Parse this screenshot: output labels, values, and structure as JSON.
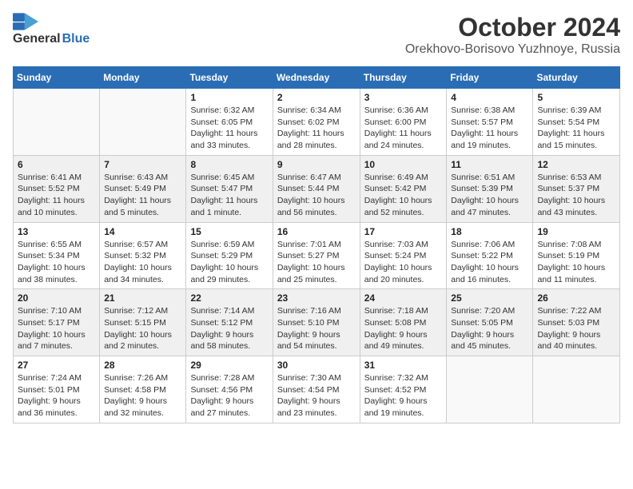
{
  "header": {
    "logo_general": "General",
    "logo_blue": "Blue",
    "month_title": "October 2024",
    "location": "Orekhovo-Borisovo Yuzhnoye, Russia"
  },
  "days_of_week": [
    "Sunday",
    "Monday",
    "Tuesday",
    "Wednesday",
    "Thursday",
    "Friday",
    "Saturday"
  ],
  "weeks": [
    [
      {
        "day": "",
        "info": ""
      },
      {
        "day": "",
        "info": ""
      },
      {
        "day": "1",
        "info": "Sunrise: 6:32 AM\nSunset: 6:05 PM\nDaylight: 11 hours and 33 minutes."
      },
      {
        "day": "2",
        "info": "Sunrise: 6:34 AM\nSunset: 6:02 PM\nDaylight: 11 hours and 28 minutes."
      },
      {
        "day": "3",
        "info": "Sunrise: 6:36 AM\nSunset: 6:00 PM\nDaylight: 11 hours and 24 minutes."
      },
      {
        "day": "4",
        "info": "Sunrise: 6:38 AM\nSunset: 5:57 PM\nDaylight: 11 hours and 19 minutes."
      },
      {
        "day": "5",
        "info": "Sunrise: 6:39 AM\nSunset: 5:54 PM\nDaylight: 11 hours and 15 minutes."
      }
    ],
    [
      {
        "day": "6",
        "info": "Sunrise: 6:41 AM\nSunset: 5:52 PM\nDaylight: 11 hours and 10 minutes."
      },
      {
        "day": "7",
        "info": "Sunrise: 6:43 AM\nSunset: 5:49 PM\nDaylight: 11 hours and 5 minutes."
      },
      {
        "day": "8",
        "info": "Sunrise: 6:45 AM\nSunset: 5:47 PM\nDaylight: 11 hours and 1 minute."
      },
      {
        "day": "9",
        "info": "Sunrise: 6:47 AM\nSunset: 5:44 PM\nDaylight: 10 hours and 56 minutes."
      },
      {
        "day": "10",
        "info": "Sunrise: 6:49 AM\nSunset: 5:42 PM\nDaylight: 10 hours and 52 minutes."
      },
      {
        "day": "11",
        "info": "Sunrise: 6:51 AM\nSunset: 5:39 PM\nDaylight: 10 hours and 47 minutes."
      },
      {
        "day": "12",
        "info": "Sunrise: 6:53 AM\nSunset: 5:37 PM\nDaylight: 10 hours and 43 minutes."
      }
    ],
    [
      {
        "day": "13",
        "info": "Sunrise: 6:55 AM\nSunset: 5:34 PM\nDaylight: 10 hours and 38 minutes."
      },
      {
        "day": "14",
        "info": "Sunrise: 6:57 AM\nSunset: 5:32 PM\nDaylight: 10 hours and 34 minutes."
      },
      {
        "day": "15",
        "info": "Sunrise: 6:59 AM\nSunset: 5:29 PM\nDaylight: 10 hours and 29 minutes."
      },
      {
        "day": "16",
        "info": "Sunrise: 7:01 AM\nSunset: 5:27 PM\nDaylight: 10 hours and 25 minutes."
      },
      {
        "day": "17",
        "info": "Sunrise: 7:03 AM\nSunset: 5:24 PM\nDaylight: 10 hours and 20 minutes."
      },
      {
        "day": "18",
        "info": "Sunrise: 7:06 AM\nSunset: 5:22 PM\nDaylight: 10 hours and 16 minutes."
      },
      {
        "day": "19",
        "info": "Sunrise: 7:08 AM\nSunset: 5:19 PM\nDaylight: 10 hours and 11 minutes."
      }
    ],
    [
      {
        "day": "20",
        "info": "Sunrise: 7:10 AM\nSunset: 5:17 PM\nDaylight: 10 hours and 7 minutes."
      },
      {
        "day": "21",
        "info": "Sunrise: 7:12 AM\nSunset: 5:15 PM\nDaylight: 10 hours and 2 minutes."
      },
      {
        "day": "22",
        "info": "Sunrise: 7:14 AM\nSunset: 5:12 PM\nDaylight: 9 hours and 58 minutes."
      },
      {
        "day": "23",
        "info": "Sunrise: 7:16 AM\nSunset: 5:10 PM\nDaylight: 9 hours and 54 minutes."
      },
      {
        "day": "24",
        "info": "Sunrise: 7:18 AM\nSunset: 5:08 PM\nDaylight: 9 hours and 49 minutes."
      },
      {
        "day": "25",
        "info": "Sunrise: 7:20 AM\nSunset: 5:05 PM\nDaylight: 9 hours and 45 minutes."
      },
      {
        "day": "26",
        "info": "Sunrise: 7:22 AM\nSunset: 5:03 PM\nDaylight: 9 hours and 40 minutes."
      }
    ],
    [
      {
        "day": "27",
        "info": "Sunrise: 7:24 AM\nSunset: 5:01 PM\nDaylight: 9 hours and 36 minutes."
      },
      {
        "day": "28",
        "info": "Sunrise: 7:26 AM\nSunset: 4:58 PM\nDaylight: 9 hours and 32 minutes."
      },
      {
        "day": "29",
        "info": "Sunrise: 7:28 AM\nSunset: 4:56 PM\nDaylight: 9 hours and 27 minutes."
      },
      {
        "day": "30",
        "info": "Sunrise: 7:30 AM\nSunset: 4:54 PM\nDaylight: 9 hours and 23 minutes."
      },
      {
        "day": "31",
        "info": "Sunrise: 7:32 AM\nSunset: 4:52 PM\nDaylight: 9 hours and 19 minutes."
      },
      {
        "day": "",
        "info": ""
      },
      {
        "day": "",
        "info": ""
      }
    ]
  ]
}
